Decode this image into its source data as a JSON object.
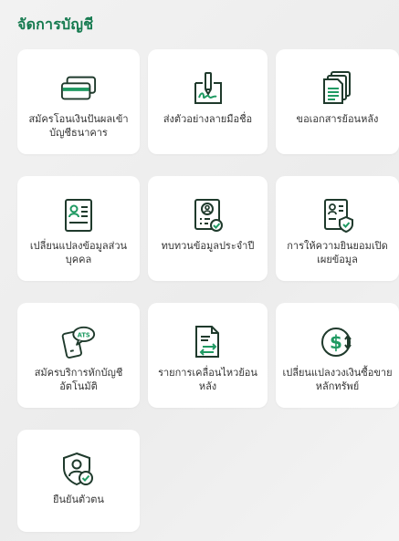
{
  "page": {
    "title": "จัดการบัญชี"
  },
  "colors": {
    "accent": "#157a4f",
    "icon_stroke": "#1f3a2c",
    "icon_green": "#1f9a62"
  },
  "menu": [
    {
      "label": "สมัครโอนเงินปันผลเข้าบัญชีธนาคาร",
      "icon": "bank-card-icon"
    },
    {
      "label": "ส่งตัวอย่างลายมือชื่อ",
      "icon": "signature-icon"
    },
    {
      "label": "ขอเอกสารย้อนหลัง",
      "icon": "documents-icon"
    },
    {
      "label": "เปลี่ยนแปลงข้อมูลส่วนบุคคล",
      "icon": "id-card-icon"
    },
    {
      "label": "ทบทวนข้อมูลประจำปี",
      "icon": "profile-review-icon"
    },
    {
      "label": "การให้ความยินยอมเปิดเผยข้อมูล",
      "icon": "consent-shield-icon"
    },
    {
      "label": "สมัครบริการหักบัญชีอัตโนมัติ",
      "icon": "ats-phone-icon"
    },
    {
      "label": "รายการเคลื่อนไหวย้อนหลัง",
      "icon": "transaction-history-icon"
    },
    {
      "label": "เปลี่ยนแปลงวงเงินซื้อขายหลักทรัพย์",
      "icon": "dollar-exchange-icon"
    },
    {
      "label": "ยืนยันตัวตน",
      "icon": "verify-identity-icon"
    }
  ]
}
